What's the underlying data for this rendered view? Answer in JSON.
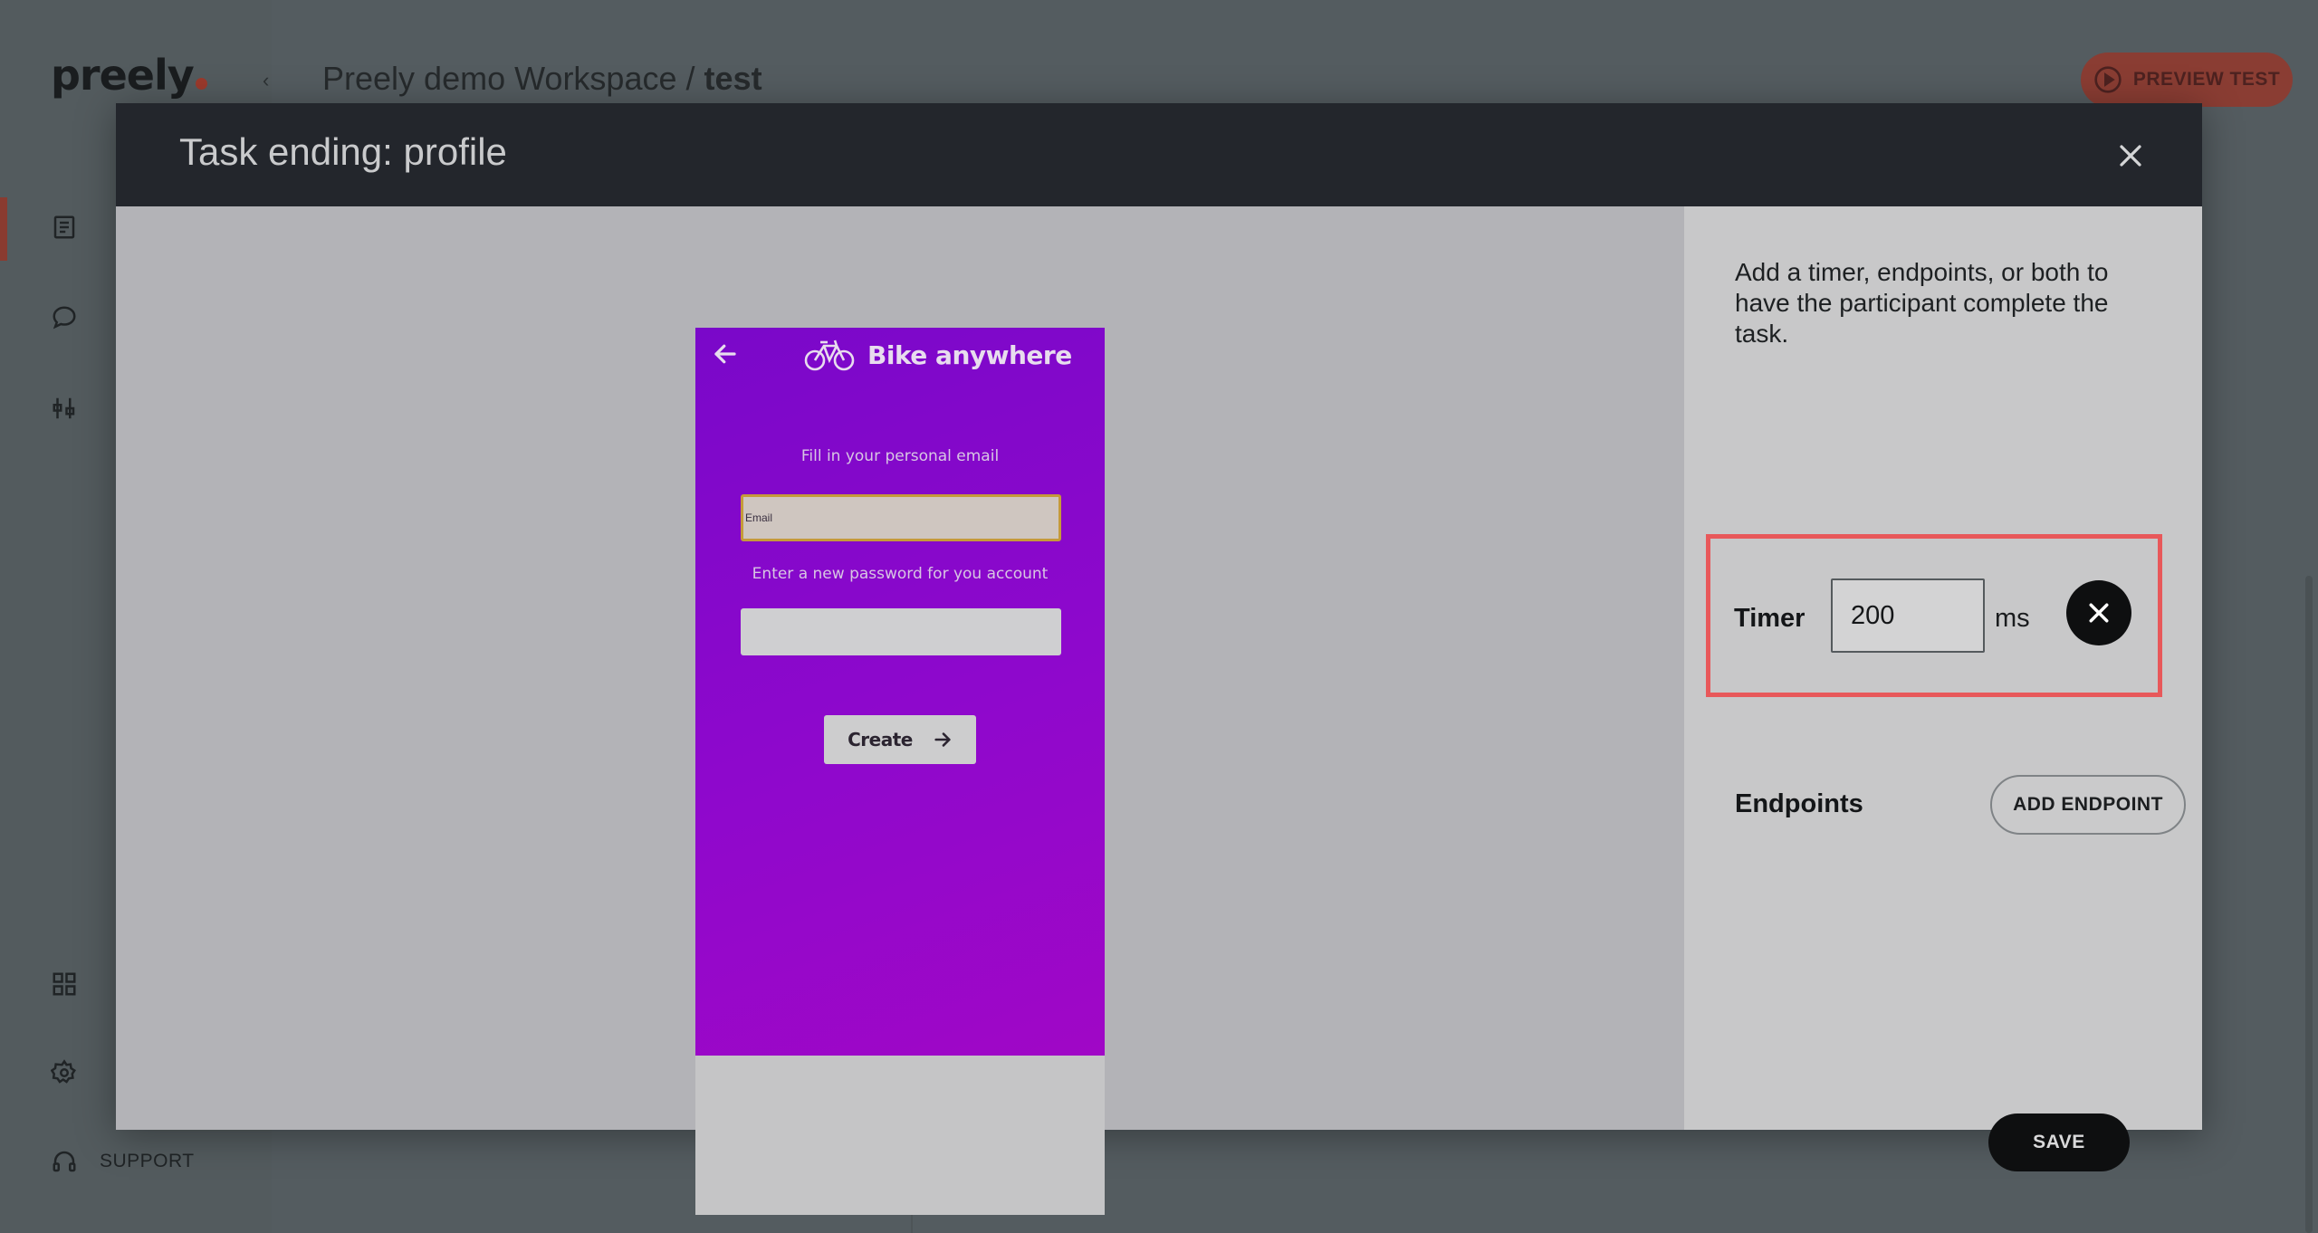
{
  "app": {
    "logo_text": "preely",
    "breadcrumb_workspace": "Preely demo Workspace /",
    "breadcrumb_current": "test",
    "preview_button_label": "PREVIEW TEST",
    "support_label": "SUPPORT",
    "sidebar_icons": [
      "document-icon",
      "chat-icon",
      "sliders-icon",
      "grid-icon",
      "settings-icon",
      "headset-icon"
    ]
  },
  "modal": {
    "title": "Task ending: profile",
    "close_icon": "close-icon",
    "intro_text": "Add a timer, endpoints, or both to have the participant complete the task.",
    "timer": {
      "label": "Timer",
      "value": "200",
      "unit": "ms",
      "remove_icon": "close-icon",
      "highlight_color": "#e8585a"
    },
    "endpoints": {
      "label": "Endpoints",
      "add_button_label": "ADD ENDPOINT"
    },
    "save_label": "SAVE"
  },
  "prototype": {
    "brand_name": "Bike anywhere",
    "brand_icon": "bicycle-icon",
    "back_icon": "arrow-left-icon",
    "email_prompt": "Fill in your personal email",
    "email_placeholder": "Email",
    "password_prompt": "Enter a new password for you account",
    "create_label": "Create",
    "create_icon": "arrow-right-icon",
    "screen_color": "#8f08cc"
  }
}
